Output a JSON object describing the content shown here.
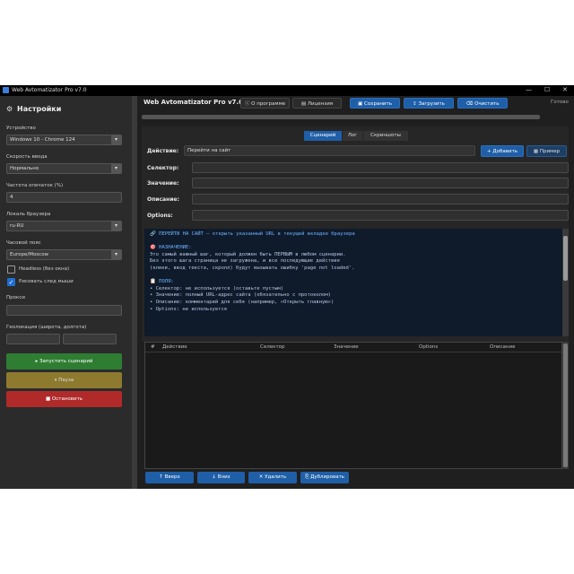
{
  "window": {
    "title": "Web Avtomatizator Pro v7.0",
    "controls": {
      "minimize": "—",
      "maximize": "☐",
      "close": "✕"
    }
  },
  "sidebar": {
    "title": "Настройки",
    "device": {
      "label": "Устройство",
      "value": "Windows 10 - Chrome 124"
    },
    "input_speed": {
      "label": "Скорость ввода",
      "value": "Нормально"
    },
    "typo_rate": {
      "label": "Частота опечаток (%)",
      "value": "4"
    },
    "locale": {
      "label": "Локаль браузера",
      "value": "ru-RU"
    },
    "timezone": {
      "label": "Часовой пояс",
      "value": "Europe/Moscow"
    },
    "headless": {
      "label": "Headless (без окна)",
      "checked": false
    },
    "draw_mouse": {
      "label": "Рисовать след мыши",
      "checked": true
    },
    "proxy": {
      "label": "Прокси",
      "value": ""
    },
    "geo": {
      "label": "Геолокация (широта, долгота)",
      "lat": "",
      "lon": ""
    },
    "run_label": "Запустить сценарий",
    "pause_label": "Пауза",
    "stop_label": "Остановить"
  },
  "toolbar": {
    "title": "Web Avtomatizator Pro v7.0",
    "about": "О программе",
    "license": "Лицензия",
    "save": "Сохранить",
    "load": "Загрузить",
    "clear": "Очистить",
    "status": "Готово"
  },
  "tabs": [
    "Сценарий",
    "Лог",
    "Скриншоты"
  ],
  "form": {
    "action_label": "Действие:",
    "action_value": "Перейти на сайт",
    "add_label": "+ Добавить",
    "example_label": "Пример",
    "selector_label": "Селектор:",
    "value_label": "Значение:",
    "description_label": "Описание:",
    "options_label": "Options:"
  },
  "info_lines": [
    "🔗 ПЕРЕЙТИ НА САЙТ — открыть указанный URL в текущей вкладке браузера",
    "",
    "🎯 НАЗНАЧЕНИЕ:",
    "Это самый важный шаг, который должен быть ПЕРВЫМ в любом сценарии.",
    "Без этого шага страница не загружена, и все последующие действия",
    "(клики, ввод текста, скролл) будут вызывать ошибку 'page not loaded'.",
    "",
    "📋 ПОЛЯ:",
    "• Селектор: не используется (оставьте пустым)",
    "• Значение: полный URL-адрес сайта (обязательно с протоколом)",
    "• Описание: комментарий для себя (например, «Открыть главную»)",
    "• Options: не используется"
  ],
  "table": {
    "columns": [
      "#",
      "Действие",
      "Селектор",
      "Значение",
      "Options",
      "Описание"
    ],
    "rows": []
  },
  "bottom": {
    "up": "↑ Вверх",
    "down": "↓ Вниз",
    "delete": "✕ Удалить",
    "duplicate": "Дублировать"
  },
  "colors": {
    "accent": "#1f5fa8",
    "run": "#2e7d32",
    "pause": "#8d7a2e",
    "stop": "#b02a2a"
  },
  "icons": {
    "settings": "gear-icon",
    "about": "info-icon",
    "license": "document-icon",
    "save": "floppy-icon",
    "load": "upload-icon",
    "clear": "broom-icon",
    "run": "play-icon",
    "pause": "pause-icon",
    "stop": "stop-icon",
    "example": "book-icon"
  }
}
